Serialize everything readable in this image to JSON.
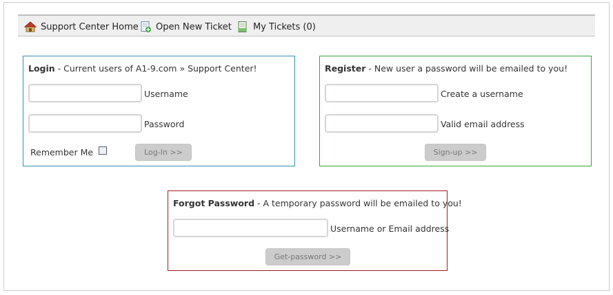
{
  "nav": {
    "items": [
      {
        "label": "Support Center Home",
        "icon": "home-icon"
      },
      {
        "label": "Open New Ticket",
        "icon": "new-ticket-icon"
      },
      {
        "label": "My Tickets (0)",
        "icon": "tickets-icon"
      }
    ]
  },
  "login": {
    "title_bold": "Login",
    "title_rest": " - Current users of A1-9.com » Support Center!",
    "username_label": "Username",
    "password_label": "Password",
    "remember_label": "Remember Me",
    "button": "Log-In >>"
  },
  "register": {
    "title_bold": "Register",
    "title_rest": " - New user a password will be emailed to you!",
    "username_label": "Create a username",
    "email_label": "Valid email address",
    "button": "Sign-up >>"
  },
  "forgot": {
    "title_bold": "Forgot Password",
    "title_rest": " - A temporary password will be emailed to you!",
    "field_label": "Username or Email address",
    "button": "Get-password >>"
  },
  "colors": {
    "login_border": "#2f8fb6",
    "register_border": "#3aa33a",
    "forgot_border": "#a11a1a"
  }
}
